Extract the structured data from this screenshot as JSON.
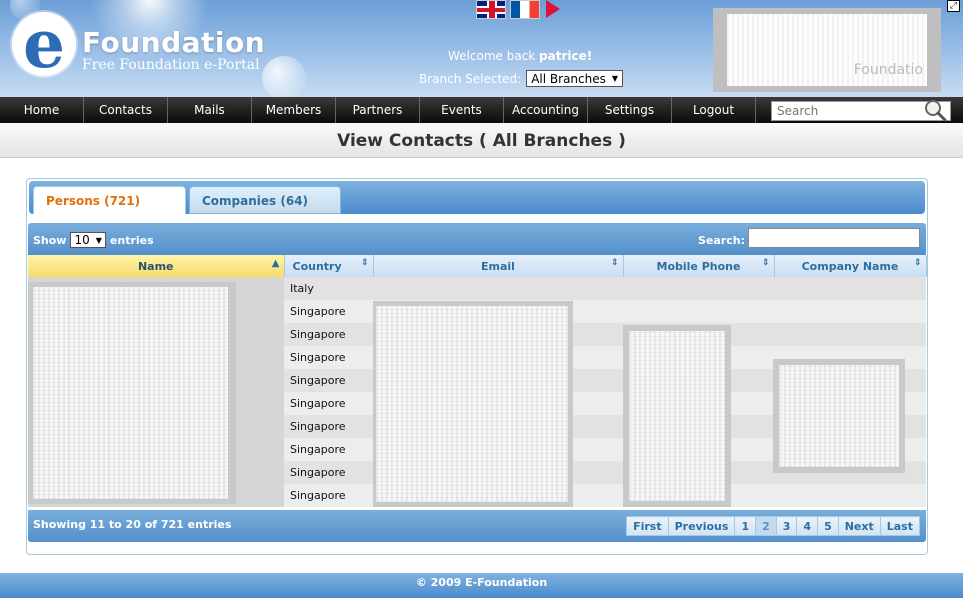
{
  "header": {
    "logo_letter": "e",
    "logo_title": "Foundation",
    "logo_subtitle": "Free Foundation e-Portal",
    "welcome_prefix": "Welcome back ",
    "welcome_user": "patrice!",
    "branch_label": "Branch Selected:",
    "branch_value": "All Branches",
    "banner_text": "Foundatio"
  },
  "nav": {
    "items": [
      "Home",
      "Contacts",
      "Mails",
      "Members",
      "Partners",
      "Events",
      "Accounting",
      "Settings",
      "Logout"
    ],
    "search_placeholder": "Search"
  },
  "page": {
    "title": "View Contacts ( All Branches )"
  },
  "tabs": [
    {
      "label": "Persons (721)",
      "active": true
    },
    {
      "label": "Companies (64)",
      "active": false
    }
  ],
  "table_controls": {
    "show_label": "Show",
    "entries_value": "10",
    "entries_label": "entries",
    "search_label": "Search:"
  },
  "table": {
    "columns": [
      "Name",
      "Country",
      "Email",
      "Mobile Phone",
      "Company Name"
    ],
    "rows": [
      {
        "country": "Italy"
      },
      {
        "country": "Singapore"
      },
      {
        "country": "Singapore"
      },
      {
        "country": "Singapore"
      },
      {
        "country": "Singapore"
      },
      {
        "country": "Singapore"
      },
      {
        "country": "Singapore"
      },
      {
        "country": "Singapore"
      },
      {
        "country": "Singapore"
      },
      {
        "country": "Singapore"
      }
    ]
  },
  "pagination": {
    "info": "Showing 11 to 20 of 721 entries",
    "first": "First",
    "previous": "Previous",
    "pages": [
      "1",
      "2",
      "3",
      "4",
      "5"
    ],
    "current_page": "2",
    "next": "Next",
    "last": "Last"
  },
  "footer": {
    "copyright": "© 2009 E-Foundation"
  },
  "colors": {
    "accent_blue": "#4a8acb",
    "active_tab_text": "#e17009",
    "nav_bg": "#1a1a1a"
  }
}
